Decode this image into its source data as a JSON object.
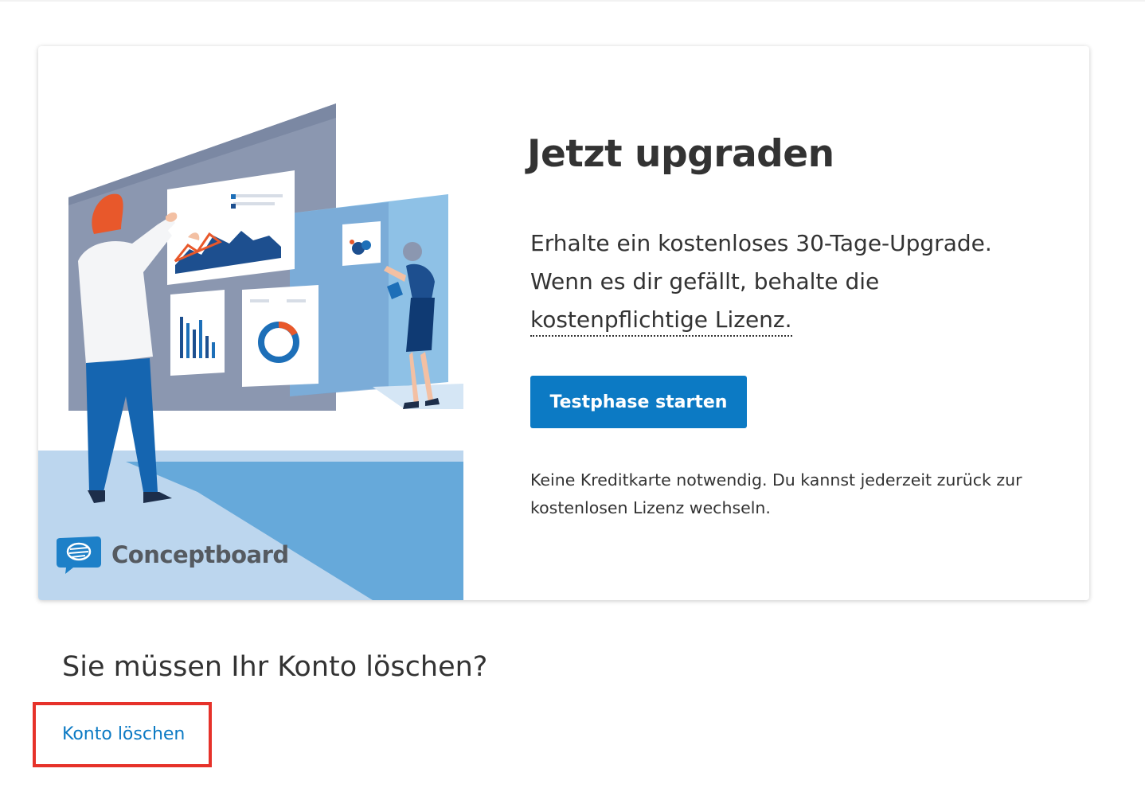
{
  "promo": {
    "headline": "Jetzt upgraden",
    "offer_line_1": "Erhalte ein kostenloses 30-Tage-Upgrade.",
    "offer_line_2": "Wenn es dir gefällt, behalte die",
    "offer_line_3": "kostenpflichtige Lizenz.",
    "trial_button_label": "Testphase starten",
    "note": "Keine Kreditkarte notwendig. Du kannst jederzeit zurück zur kostenlosen Lizenz wechseln.",
    "illustration": {
      "brand_name": "Conceptboard",
      "logo_icon": "speech-bubble-logo-icon"
    }
  },
  "account": {
    "delete_heading": "Sie müssen Ihr Konto löschen?",
    "delete_link_label": "Konto löschen"
  },
  "colors": {
    "accent_blue": "#0c7ac4",
    "highlight_red": "#e6322a",
    "text": "#333333"
  }
}
